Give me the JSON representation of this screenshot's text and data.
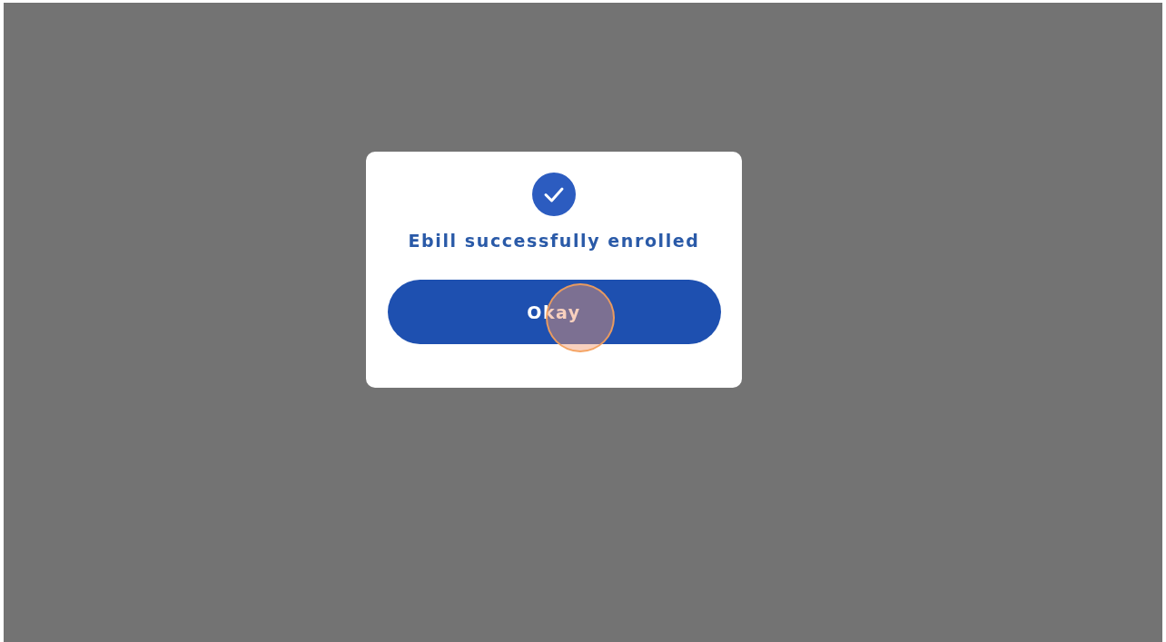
{
  "dialog": {
    "message": "Ebill successfully enrolled",
    "button": "Okay"
  }
}
